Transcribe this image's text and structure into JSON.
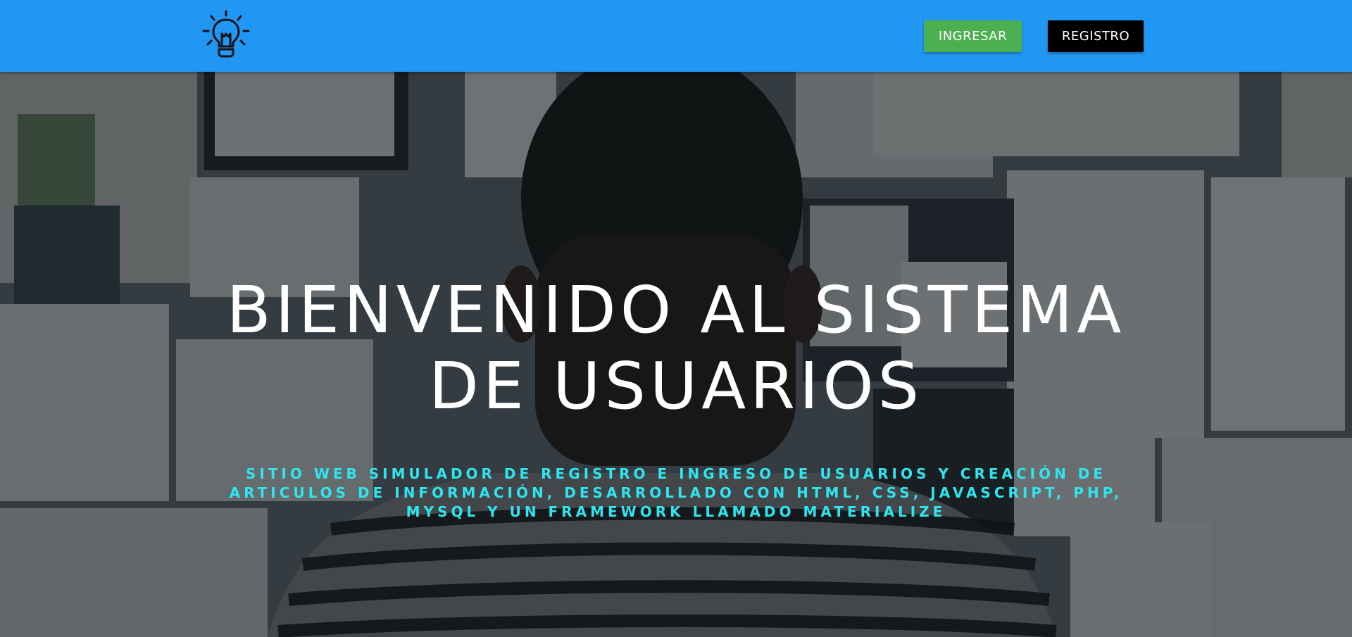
{
  "navbar": {
    "logo_icon": "lightbulb-icon",
    "login_label": "INGRESAR",
    "register_label": "REGISTRO",
    "colors": {
      "bar": "#2196f3",
      "login": "#4caf50",
      "register": "#000000"
    }
  },
  "hero": {
    "title": "BIENVENIDO AL SISTEMA DE USUARIOS",
    "subtitle": "SITIO WEB SIMULADOR DE REGISTRO E INGRESO DE USUARIOS Y CREACIÓN DE ARTICULOS DE INFORMACIÓN, DESARROLLADO CON HTML, CSS, JAVASCRIPT, PHP, MYSQL Y UN FRAMEWORK LLAMADO MATERIALIZE",
    "subtitle_color": "#2ee6f0"
  }
}
